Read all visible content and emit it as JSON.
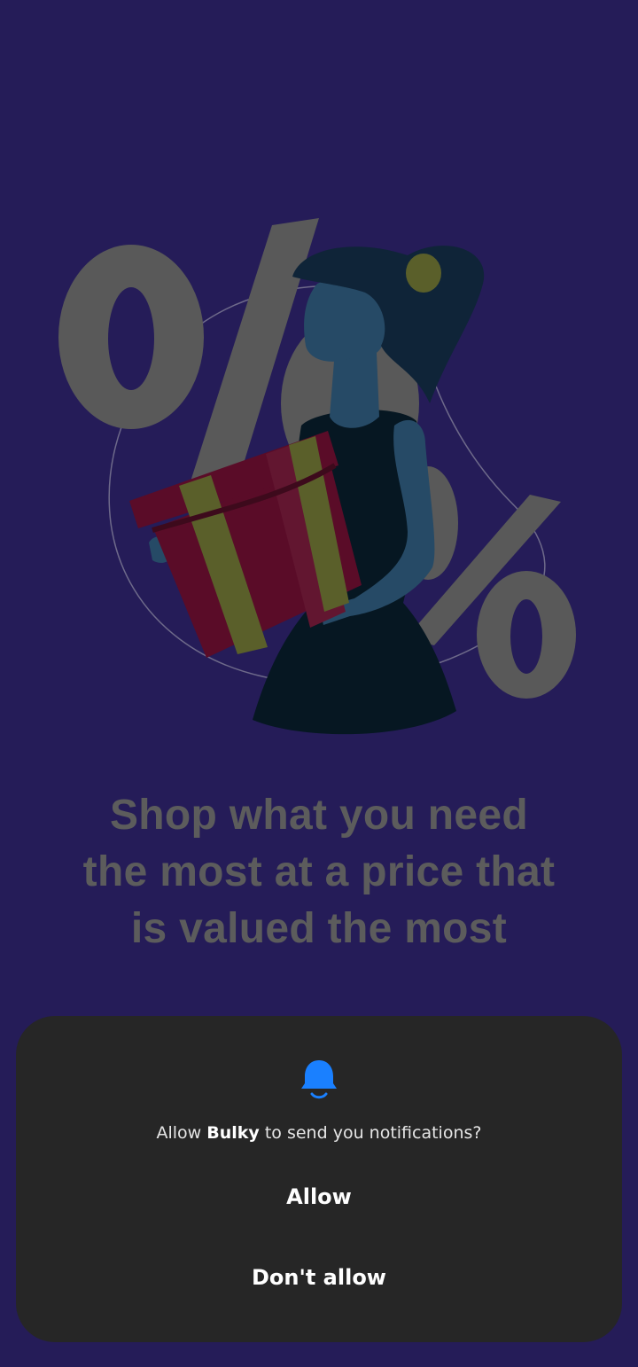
{
  "onboarding": {
    "headline": "Shop what you need the most at a price that is valued the most",
    "illustration_icon": "woman-holding-gift-with-percent-signs-illustration"
  },
  "permission_dialog": {
    "icon": "bell-icon",
    "prompt_prefix": "Allow ",
    "app_name": "Bulky",
    "prompt_suffix": " to send you notifications?",
    "allow_label": "Allow",
    "deny_label": "Don't allow"
  },
  "colors": {
    "background": "#251c58",
    "dialog_background": "#262626",
    "bell_accent": "#1a80ff",
    "headline_text": "#5c5c5c",
    "gift_red": "#5a0c28",
    "gift_ribbon": "#5a5f2a"
  }
}
